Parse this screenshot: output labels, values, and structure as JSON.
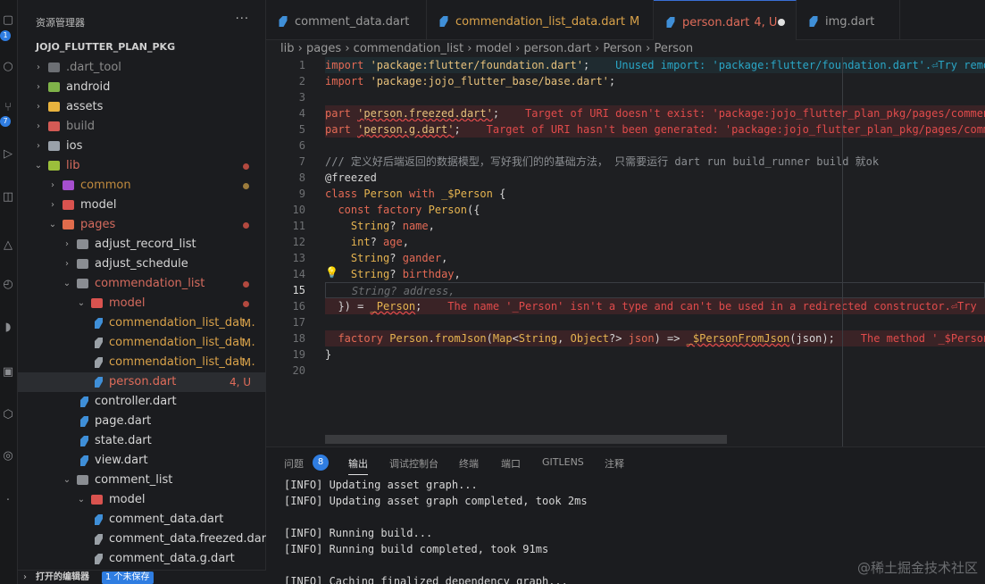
{
  "activity_bar": {
    "badges": [
      "1",
      "7"
    ]
  },
  "sidebar": {
    "title": "资源管理器",
    "more": "···",
    "root": "JOJO_FLUTTER_PLAN_PKG",
    "footer_label": "打开的编辑器",
    "footer_badge": "1 个未保存",
    "tree": [
      {
        "label": ".dart_tool",
        "depth": 0,
        "kind": "folder",
        "chev": "›",
        "color": "#8a8a8a",
        "icolor": "#6c6f74"
      },
      {
        "label": "android",
        "depth": 0,
        "kind": "folder",
        "chev": "›",
        "color": "#d6d6d6",
        "icolor": "#7fb349"
      },
      {
        "label": "assets",
        "depth": 0,
        "kind": "folder",
        "chev": "›",
        "color": "#d6d6d6",
        "icolor": "#e8b33e"
      },
      {
        "label": "build",
        "depth": 0,
        "kind": "folder",
        "chev": "›",
        "color": "#8a8a8a",
        "icolor": "#d35a55"
      },
      {
        "label": "ios",
        "depth": 0,
        "kind": "folder",
        "chev": "›",
        "color": "#d6d6d6",
        "icolor": "#9aa1aa"
      },
      {
        "label": "lib",
        "depth": 0,
        "kind": "folder-open",
        "chev": "⌄",
        "color": "#d56b5e",
        "icolor": "#9bbf3b",
        "dot": "r"
      },
      {
        "label": "common",
        "depth": 1,
        "kind": "folder",
        "chev": "›",
        "color": "#c08a3e",
        "icolor": "#a64fcf",
        "dot": "y"
      },
      {
        "label": "model",
        "depth": 1,
        "kind": "folder",
        "chev": "›",
        "color": "#d6d6d6",
        "icolor": "#d9534f"
      },
      {
        "label": "pages",
        "depth": 1,
        "kind": "folder-open",
        "chev": "⌄",
        "color": "#d56b5e",
        "icolor": "#e06c4c",
        "dot": "r"
      },
      {
        "label": "adjust_record_list",
        "depth": 2,
        "kind": "folder",
        "chev": "›",
        "color": "#d6d6d6",
        "icolor": "#8a8d92"
      },
      {
        "label": "adjust_schedule",
        "depth": 2,
        "kind": "folder",
        "chev": "›",
        "color": "#d6d6d6",
        "icolor": "#8a8d92"
      },
      {
        "label": "commendation_list",
        "depth": 2,
        "kind": "folder-open",
        "chev": "⌄",
        "color": "#d56b5e",
        "icolor": "#8a8d92",
        "dot": "r"
      },
      {
        "label": "model",
        "depth": 3,
        "kind": "folder-open",
        "chev": "⌄",
        "color": "#d56b5e",
        "icolor": "#d9534f",
        "dot": "r"
      },
      {
        "label": "commendation_list_dat...",
        "depth": 4,
        "kind": "dart",
        "color": "#d9a24a",
        "icolor": "#3f8fd8",
        "mark": "M",
        "mcolor": "#d9a24a"
      },
      {
        "label": "commendation_list_dat...",
        "depth": 4,
        "kind": "dart",
        "color": "#d9a24a",
        "icolor": "#9aa0a6",
        "mark": "M",
        "mcolor": "#d9a24a"
      },
      {
        "label": "commendation_list_dat...",
        "depth": 4,
        "kind": "dart",
        "color": "#d9a24a",
        "icolor": "#9aa0a6",
        "mark": "M",
        "mcolor": "#d9a24a"
      },
      {
        "label": "person.dart",
        "depth": 4,
        "kind": "dart",
        "color": "#e06c5a",
        "icolor": "#3f8fd8",
        "mark": "4, U",
        "mcolor": "#e06c5a",
        "selected": true
      },
      {
        "label": "controller.dart",
        "depth": 3,
        "kind": "dart",
        "color": "#d6d6d6",
        "icolor": "#3f8fd8"
      },
      {
        "label": "page.dart",
        "depth": 3,
        "kind": "dart",
        "color": "#d6d6d6",
        "icolor": "#3f8fd8"
      },
      {
        "label": "state.dart",
        "depth": 3,
        "kind": "dart",
        "color": "#d6d6d6",
        "icolor": "#3f8fd8"
      },
      {
        "label": "view.dart",
        "depth": 3,
        "kind": "dart",
        "color": "#d6d6d6",
        "icolor": "#3f8fd8"
      },
      {
        "label": "comment_list",
        "depth": 2,
        "kind": "folder-open",
        "chev": "⌄",
        "color": "#d6d6d6",
        "icolor": "#8a8d92"
      },
      {
        "label": "model",
        "depth": 3,
        "kind": "folder-open",
        "chev": "⌄",
        "color": "#d6d6d6",
        "icolor": "#d9534f"
      },
      {
        "label": "comment_data.dart",
        "depth": 4,
        "kind": "dart",
        "color": "#d6d6d6",
        "icolor": "#3f8fd8"
      },
      {
        "label": "comment_data.freezed.dart",
        "depth": 4,
        "kind": "dart",
        "color": "#d6d6d6",
        "icolor": "#9aa0a6"
      },
      {
        "label": "comment_data.g.dart",
        "depth": 4,
        "kind": "dart",
        "color": "#d6d6d6",
        "icolor": "#9aa0a6"
      }
    ]
  },
  "tabs": [
    {
      "label": "comment_data.dart",
      "suffix": "",
      "color": "#9a9a9a",
      "active": false
    },
    {
      "label": "commendation_list_data.dart",
      "suffix": "M",
      "color": "#d9a24a",
      "active": false
    },
    {
      "label": "person.dart",
      "suffix": "4, U",
      "color": "#e06c5a",
      "active": true
    },
    {
      "label": "img.dart",
      "suffix": "",
      "color": "#9a9a9a",
      "active": false
    }
  ],
  "breadcrumb": [
    "lib",
    "pages",
    "commendation_list",
    "model",
    "person.dart",
    "Person",
    "Person"
  ],
  "editor": {
    "line_numbers": [
      "1",
      "2",
      "3",
      "4",
      "5",
      "6",
      "7",
      "8",
      "9",
      "10",
      "11",
      "12",
      "13",
      "14",
      "15",
      "16",
      "17",
      "18",
      "19",
      "20"
    ],
    "current_line": "15",
    "lines": [
      {
        "bg": "warn",
        "parts": [
          [
            "kw",
            "import "
          ],
          [
            "str",
            "'package:flutter/foundation.dart'"
          ],
          [
            "pl",
            ";    "
          ],
          [
            "msg-warn",
            "Unused import: 'package:flutter/foundation.dart'.⏎Try remo"
          ]
        ]
      },
      {
        "bg": "",
        "parts": [
          [
            "kw",
            "import "
          ],
          [
            "str",
            "'package:jojo_flutter_base/base.dart'"
          ],
          [
            "pl",
            ";"
          ]
        ]
      },
      {
        "bg": "",
        "parts": []
      },
      {
        "bg": "err",
        "parts": [
          [
            "kw",
            "part "
          ],
          [
            "str squig",
            "'person.freezed.dart'"
          ],
          [
            "pl",
            ";    "
          ],
          [
            "msg-err",
            "Target of URI doesn't exist: 'package:jojo_flutter_plan_pkg/pages/commen"
          ]
        ]
      },
      {
        "bg": "err",
        "parts": [
          [
            "kw",
            "part "
          ],
          [
            "str squig",
            "'person.g.dart'"
          ],
          [
            "pl",
            ";    "
          ],
          [
            "msg-err",
            "Target of URI hasn't been generated: 'package:jojo_flutter_plan_pkg/pages/comm"
          ]
        ]
      },
      {
        "bg": "",
        "parts": []
      },
      {
        "bg": "",
        "parts": [
          [
            "cm",
            "/// 定义好后端返回的数据模型，写好我们的的基础方法， 只需要运行 dart run build_runner build 就ok"
          ]
        ]
      },
      {
        "bg": "",
        "parts": [
          [
            "pl",
            "@freezed"
          ]
        ]
      },
      {
        "bg": "",
        "parts": [
          [
            "kw",
            "class "
          ],
          [
            "ty",
            "Person "
          ],
          [
            "kw",
            "with "
          ],
          [
            "ty",
            "_$Person "
          ],
          [
            "pl",
            "{"
          ]
        ]
      },
      {
        "bg": "",
        "parts": [
          [
            "pl",
            "  "
          ],
          [
            "kw",
            "const factory "
          ],
          [
            "fn",
            "Person"
          ],
          [
            "pl",
            "({"
          ]
        ]
      },
      {
        "bg": "",
        "parts": [
          [
            "pl",
            "    "
          ],
          [
            "ty",
            "String"
          ],
          [
            "pl",
            "? "
          ],
          [
            "kw",
            "name"
          ],
          [
            "pl",
            ","
          ]
        ]
      },
      {
        "bg": "",
        "parts": [
          [
            "pl",
            "    "
          ],
          [
            "ty",
            "int"
          ],
          [
            "pl",
            "? "
          ],
          [
            "kw",
            "age"
          ],
          [
            "pl",
            ","
          ]
        ]
      },
      {
        "bg": "",
        "parts": [
          [
            "pl",
            "    "
          ],
          [
            "ty",
            "String"
          ],
          [
            "pl",
            "? "
          ],
          [
            "kw",
            "gander"
          ],
          [
            "pl",
            ","
          ]
        ]
      },
      {
        "bg": "",
        "parts": [
          [
            "pl",
            "    "
          ],
          [
            "ty",
            "String"
          ],
          [
            "pl",
            "? "
          ],
          [
            "kw",
            "birthday"
          ],
          [
            "pl",
            ","
          ]
        ]
      },
      {
        "bg": "curline",
        "parts": [
          [
            "pl",
            "    "
          ],
          [
            "ghost",
            "String? address,"
          ]
        ]
      },
      {
        "bg": "err",
        "parts": [
          [
            "pl",
            "  }) = "
          ],
          [
            "ty squig",
            "_Person"
          ],
          [
            "pl",
            ";    "
          ],
          [
            "msg-err",
            "The name '_Person' isn't a type and can't be used in a redirected constructor.⏎Try"
          ]
        ]
      },
      {
        "bg": "",
        "parts": []
      },
      {
        "bg": "err",
        "parts": [
          [
            "pl",
            "  "
          ],
          [
            "kw",
            "factory "
          ],
          [
            "ty",
            "Person"
          ],
          [
            "pl",
            "."
          ],
          [
            "fn",
            "fromJson"
          ],
          [
            "pl",
            "("
          ],
          [
            "ty",
            "Map"
          ],
          [
            "pl",
            "<"
          ],
          [
            "ty",
            "String"
          ],
          [
            "pl",
            ", "
          ],
          [
            "ty",
            "Object"
          ],
          [
            "pl",
            "?> "
          ],
          [
            "kw",
            "json"
          ],
          [
            "pl",
            ") => "
          ],
          [
            "fn squig",
            "_$PersonFromJson"
          ],
          [
            "pl",
            "(json);    "
          ],
          [
            "msg-err",
            "The method '_$Person"
          ]
        ]
      },
      {
        "bg": "",
        "parts": [
          [
            "pl",
            "}"
          ]
        ]
      },
      {
        "bg": "",
        "parts": []
      }
    ]
  },
  "panel": {
    "tabs": [
      "问题",
      "输出",
      "调试控制台",
      "终端",
      "端口",
      "GITLENS",
      "注释"
    ],
    "problems_count": "8",
    "active_tab": "输出",
    "output": [
      "[INFO] Updating asset graph...",
      "[INFO] Updating asset graph completed, took 2ms",
      "",
      "[INFO] Running build...",
      "[INFO] Running build completed, took 91ms",
      "",
      "[INFO] Caching finalized dependency graph..."
    ]
  },
  "watermark": "@稀土掘金技术社区"
}
